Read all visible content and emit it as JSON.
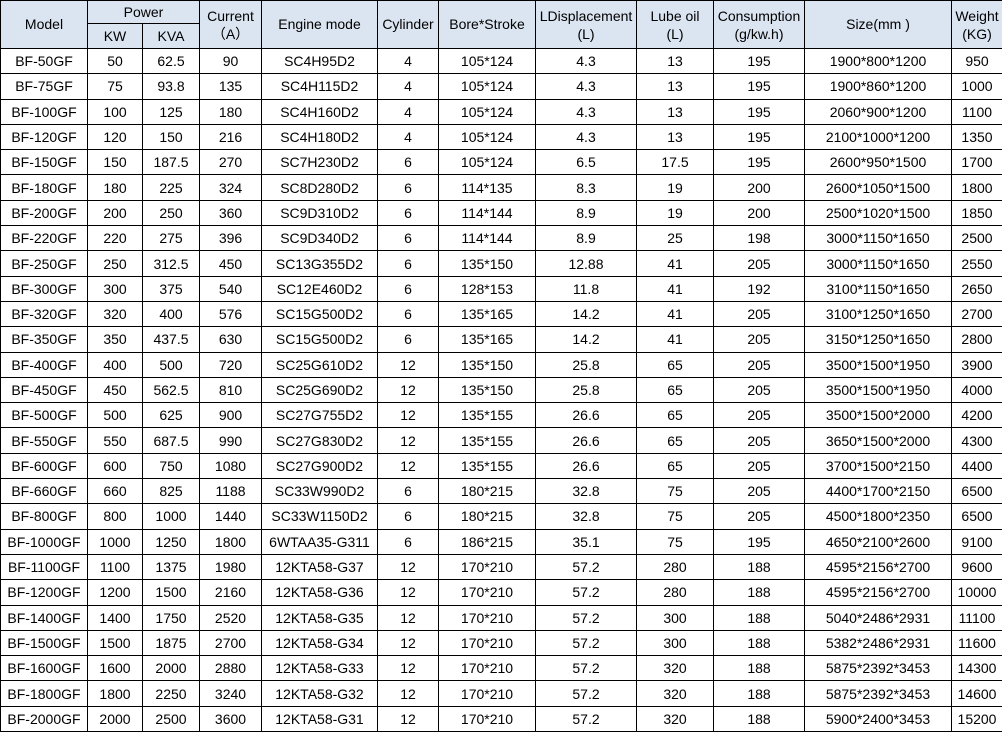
{
  "headers": {
    "model": "Model",
    "power": "Power",
    "kw": "KW",
    "kva": "KVA",
    "current_line1": "Current",
    "current_line2": "（A）",
    "engine_mode": "Engine mode",
    "cylinder": "Cylinder",
    "bore_stroke": "Bore*Stroke",
    "displacement_line1": "LDisplacement",
    "displacement_line2": "(L)",
    "lube_oil_line1": "Lube oil",
    "lube_oil_line2": "(L)",
    "consumption_line1": "Consumption",
    "consumption_line2": "(g/kw.h)",
    "size": "Size(mm )",
    "weight_line1": "Weight",
    "weight_line2": "(KG)"
  },
  "rows": [
    [
      "BF-50GF",
      "50",
      "62.5",
      "90",
      "SC4H95D2",
      "4",
      "105*124",
      "4.3",
      "13",
      "195",
      "1900*800*1200",
      "950"
    ],
    [
      "BF-75GF",
      "75",
      "93.8",
      "135",
      "SC4H115D2",
      "4",
      "105*124",
      "4.3",
      "13",
      "195",
      "1900*860*1200",
      "1000"
    ],
    [
      "BF-100GF",
      "100",
      "125",
      "180",
      "SC4H160D2",
      "4",
      "105*124",
      "4.3",
      "13",
      "195",
      "2060*900*1200",
      "1100"
    ],
    [
      "BF-120GF",
      "120",
      "150",
      "216",
      "SC4H180D2",
      "4",
      "105*124",
      "4.3",
      "13",
      "195",
      "2100*1000*1200",
      "1350"
    ],
    [
      "BF-150GF",
      "150",
      "187.5",
      "270",
      "SC7H230D2",
      "6",
      "105*124",
      "6.5",
      "17.5",
      "195",
      "2600*950*1500",
      "1700"
    ],
    [
      "BF-180GF",
      "180",
      "225",
      "324",
      "SC8D280D2",
      "6",
      "114*135",
      "8.3",
      "19",
      "200",
      "2600*1050*1500",
      "1800"
    ],
    [
      "BF-200GF",
      "200",
      "250",
      "360",
      "SC9D310D2",
      "6",
      "114*144",
      "8.9",
      "19",
      "200",
      "2500*1020*1500",
      "1850"
    ],
    [
      "BF-220GF",
      "220",
      "275",
      "396",
      "SC9D340D2",
      "6",
      "114*144",
      "8.9",
      "25",
      "198",
      "3000*1150*1650",
      "2500"
    ],
    [
      "BF-250GF",
      "250",
      "312.5",
      "450",
      "SC13G355D2",
      "6",
      "135*150",
      "12.88",
      "41",
      "205",
      "3000*1150*1650",
      "2550"
    ],
    [
      "BF-300GF",
      "300",
      "375",
      "540",
      "SC12E460D2",
      "6",
      "128*153",
      "11.8",
      "41",
      "192",
      "3100*1150*1650",
      "2650"
    ],
    [
      "BF-320GF",
      "320",
      "400",
      "576",
      "SC15G500D2",
      "6",
      "135*165",
      "14.2",
      "41",
      "205",
      "3100*1250*1650",
      "2700"
    ],
    [
      "BF-350GF",
      "350",
      "437.5",
      "630",
      "SC15G500D2",
      "6",
      "135*165",
      "14.2",
      "41",
      "205",
      "3150*1250*1650",
      "2800"
    ],
    [
      "BF-400GF",
      "400",
      "500",
      "720",
      "SC25G610D2",
      "12",
      "135*150",
      "25.8",
      "65",
      "205",
      "3500*1500*1950",
      "3900"
    ],
    [
      "BF-450GF",
      "450",
      "562.5",
      "810",
      "SC25G690D2",
      "12",
      "135*150",
      "25.8",
      "65",
      "205",
      "3500*1500*1950",
      "4000"
    ],
    [
      "BF-500GF",
      "500",
      "625",
      "900",
      "SC27G755D2",
      "12",
      "135*155",
      "26.6",
      "65",
      "205",
      "3500*1500*2000",
      "4200"
    ],
    [
      "BF-550GF",
      "550",
      "687.5",
      "990",
      "SC27G830D2",
      "12",
      "135*155",
      "26.6",
      "65",
      "205",
      "3650*1500*2000",
      "4300"
    ],
    [
      "BF-600GF",
      "600",
      "750",
      "1080",
      "SC27G900D2",
      "12",
      "135*155",
      "26.6",
      "65",
      "205",
      "3700*1500*2150",
      "4400"
    ],
    [
      "BF-660GF",
      "660",
      "825",
      "1188",
      "SC33W990D2",
      "6",
      "180*215",
      "32.8",
      "75",
      "205",
      "4400*1700*2150",
      "6500"
    ],
    [
      "BF-800GF",
      "800",
      "1000",
      "1440",
      "SC33W1150D2",
      "6",
      "180*215",
      "32.8",
      "75",
      "205",
      "4500*1800*2350",
      "6500"
    ],
    [
      "BF-1000GF",
      "1000",
      "1250",
      "1800",
      "6WTAA35-G311",
      "6",
      "186*215",
      "35.1",
      "75",
      "195",
      "4650*2100*2600",
      "9100"
    ],
    [
      "BF-1100GF",
      "1100",
      "1375",
      "1980",
      "12KTA58-G37",
      "12",
      "170*210",
      "57.2",
      "280",
      "188",
      "4595*2156*2700",
      "9600"
    ],
    [
      "BF-1200GF",
      "1200",
      "1500",
      "2160",
      "12KTA58-G36",
      "12",
      "170*210",
      "57.2",
      "280",
      "188",
      "4595*2156*2700",
      "10000"
    ],
    [
      "BF-1400GF",
      "1400",
      "1750",
      "2520",
      "12KTA58-G35",
      "12",
      "170*210",
      "57.2",
      "300",
      "188",
      "5040*2486*2931",
      "11100"
    ],
    [
      "BF-1500GF",
      "1500",
      "1875",
      "2700",
      "12KTA58-G34",
      "12",
      "170*210",
      "57.2",
      "300",
      "188",
      "5382*2486*2931",
      "11600"
    ],
    [
      "BF-1600GF",
      "1600",
      "2000",
      "2880",
      "12KTA58-G33",
      "12",
      "170*210",
      "57.2",
      "320",
      "188",
      "5875*2392*3453",
      "14300"
    ],
    [
      "BF-1800GF",
      "1800",
      "2250",
      "3240",
      "12KTA58-G32",
      "12",
      "170*210",
      "57.2",
      "320",
      "188",
      "5875*2392*3453",
      "14600"
    ],
    [
      "BF-2000GF",
      "2000",
      "2500",
      "3600",
      "12KTA58-G31",
      "12",
      "170*210",
      "57.2",
      "320",
      "188",
      "5900*2400*3453",
      "15200"
    ]
  ]
}
